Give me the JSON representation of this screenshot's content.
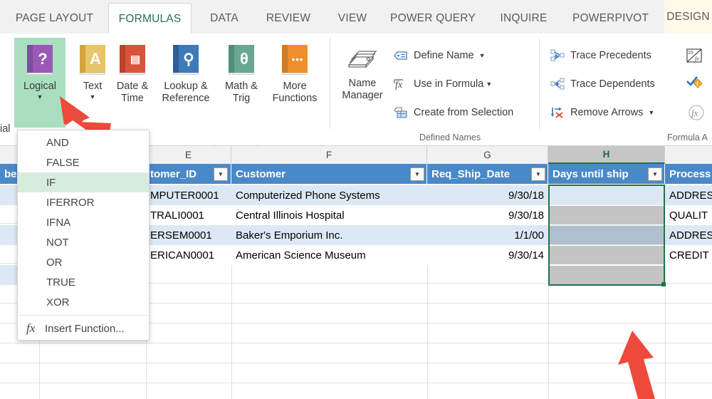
{
  "ribbon": {
    "tabs": [
      {
        "label": "PAGE LAYOUT",
        "state": "normal"
      },
      {
        "label": "FORMULAS",
        "state": "active"
      },
      {
        "label": "DATA",
        "state": "normal"
      },
      {
        "label": "REVIEW",
        "state": "normal"
      },
      {
        "label": "VIEW",
        "state": "normal"
      },
      {
        "label": "POWER QUERY",
        "state": "normal"
      },
      {
        "label": "INQUIRE",
        "state": "normal"
      },
      {
        "label": "POWERPIVOT",
        "state": "normal"
      },
      {
        "label": "DESIGN",
        "state": "contextual"
      }
    ],
    "function_library": {
      "partial_label": "ial",
      "buttons": [
        {
          "label": "Logical",
          "icon": "question-book-icon",
          "selected": true,
          "dropdown": true,
          "spine": "#7a4f9e",
          "face": "#9b59b6",
          "glyph": "?"
        },
        {
          "label": "Text",
          "icon": "letter-a-book-icon",
          "selected": false,
          "dropdown": true,
          "spine": "#d4a43c",
          "face": "#e8c46a",
          "glyph": "A"
        },
        {
          "label": "Date &\nTime",
          "icon": "calendar-book-icon",
          "selected": false,
          "dropdown": true,
          "spine": "#b8422c",
          "face": "#d9543a",
          "glyph": "☷"
        },
        {
          "label": "Lookup &\nReference",
          "icon": "magnifier-book-icon",
          "selected": false,
          "dropdown": true,
          "spine": "#2d5f96",
          "face": "#3d7ab8",
          "glyph": "⌕"
        },
        {
          "label": "Math &\nTrig",
          "icon": "theta-book-icon",
          "selected": false,
          "dropdown": true,
          "spine": "#4d8f78",
          "face": "#6aa791",
          "glyph": "θ"
        },
        {
          "label": "More\nFunctions",
          "icon": "ellipsis-book-icon",
          "selected": false,
          "dropdown": true,
          "spine": "#d37b1e",
          "face": "#ef8f2c",
          "glyph": "•••"
        }
      ]
    },
    "defined_names": {
      "group_label": "Defined Names",
      "name_manager": {
        "label": "Name\nManager",
        "icon": "card-file-box-icon"
      },
      "commands": [
        {
          "label": "Define Name",
          "icon": "define-name-icon",
          "dropdown": true
        },
        {
          "label": "Use in Formula",
          "icon": "use-in-formula-icon",
          "dropdown": true
        },
        {
          "label": "Create from Selection",
          "icon": "create-from-selection-icon",
          "dropdown": false
        }
      ]
    },
    "formula_auditing": {
      "group_label": "Formula A",
      "commands": [
        {
          "label": "Trace Precedents",
          "icon": "trace-precedents-icon",
          "dropdown": false
        },
        {
          "label": "Trace Dependents",
          "icon": "trace-dependents-icon",
          "dropdown": false
        },
        {
          "label": "Remove Arrows",
          "icon": "remove-arrows-icon",
          "dropdown": true
        }
      ],
      "right_icons": [
        {
          "icon": "show-formulas-icon"
        },
        {
          "icon": "error-checking-icon"
        },
        {
          "icon": "evaluate-formula-icon"
        }
      ]
    }
  },
  "logical_menu": {
    "items": [
      {
        "label": "AND",
        "highlighted": false
      },
      {
        "label": "FALSE",
        "highlighted": false
      },
      {
        "label": "IF",
        "highlighted": true
      },
      {
        "label": "IFERROR",
        "highlighted": false
      },
      {
        "label": "IFNA",
        "highlighted": false
      },
      {
        "label": "NOT",
        "highlighted": false
      },
      {
        "label": "OR",
        "highlighted": false
      },
      {
        "label": "TRUE",
        "highlighted": false
      },
      {
        "label": "XOR",
        "highlighted": false
      }
    ],
    "insert_function": {
      "label": "Insert Function...",
      "icon": "fx-icon"
    }
  },
  "spreadsheet": {
    "column_headers": [
      {
        "letter": "E",
        "selected": false
      },
      {
        "letter": "F",
        "selected": false
      },
      {
        "letter": "G",
        "selected": false
      },
      {
        "letter": "H",
        "selected": true
      }
    ],
    "table_headers": [
      {
        "label": "ber",
        "partial": true
      },
      {
        "label": "tomer_ID",
        "partial": true
      },
      {
        "label": "Customer",
        "partial": false
      },
      {
        "label": "Req_Ship_Date",
        "partial": false
      },
      {
        "label": "Days until ship",
        "partial": false
      },
      {
        "label": "Process",
        "partial": true
      }
    ],
    "rows": [
      {
        "banded": true,
        "customer_id": "MPUTER0001",
        "customer": "Computerized Phone Systems",
        "req_ship_date": "9/30/18",
        "days_until_ship": "",
        "process": "ADDRES"
      },
      {
        "banded": false,
        "customer_id": "TRALI0001",
        "customer": "Central Illinois Hospital",
        "req_ship_date": "9/30/18",
        "days_until_ship": "",
        "process": "QUALIT"
      },
      {
        "banded": true,
        "customer_id": "ERSEM0001",
        "customer": "Baker's Emporium Inc.",
        "req_ship_date": "1/1/00",
        "days_until_ship": "",
        "process": "ADDRES"
      },
      {
        "banded": false,
        "customer_id": "ERICAN0001",
        "customer": "American Science Museum",
        "req_ship_date": "9/30/14",
        "days_until_ship": "",
        "process": "CREDIT"
      },
      {
        "banded": true,
        "customer_id": "",
        "customer": "",
        "req_ship_date": "",
        "days_until_ship": "",
        "process": ""
      }
    ],
    "selected_column_letter": "H"
  },
  "annotations": {
    "arrow_color": "#ec4a3a",
    "arrows": [
      {
        "name": "arrow-to-logical-button",
        "target": "Logical"
      },
      {
        "name": "arrow-to-if-menu-item",
        "target": "IF"
      },
      {
        "name": "arrow-to-days-until-ship-column",
        "target": "Days until ship"
      }
    ]
  }
}
